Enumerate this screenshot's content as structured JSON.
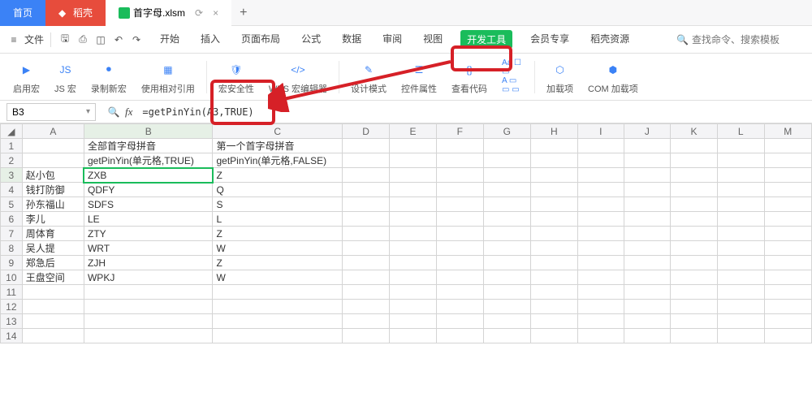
{
  "tabs": {
    "home": "首页",
    "docer": "稻壳",
    "file_icon": "S",
    "file": "首字母.xlsm",
    "plus": "+"
  },
  "menubar": {
    "file_menu": "文件",
    "items": [
      "开始",
      "插入",
      "页面布局",
      "公式",
      "数据",
      "审阅",
      "视图",
      "开发工具",
      "会员专享",
      "稻壳资源"
    ],
    "active_index": 7,
    "search_placeholder": "查找命令、搜索模板"
  },
  "ribbon": {
    "buttons": [
      "启用宏",
      "JS 宏",
      "录制新宏",
      "使用相对引用",
      "宏安全性",
      "WPS 宏编辑器",
      "设计模式",
      "控件属性",
      "查看代码",
      "",
      "加载项",
      "COM 加载项"
    ]
  },
  "namebox": {
    "cell": "B3"
  },
  "formula": {
    "value": "=getPinYin(A3,TRUE)"
  },
  "columns": [
    "A",
    "B",
    "C",
    "D",
    "E",
    "F",
    "G",
    "H",
    "I",
    "J",
    "K",
    "L",
    "M"
  ],
  "rows": [
    {
      "n": 1,
      "A": "",
      "B": "全部首字母拼音",
      "C": "第一个首字母拼音"
    },
    {
      "n": 2,
      "A": "",
      "B": "getPinYin(单元格,TRUE)",
      "C": "getPinYin(单元格,FALSE)"
    },
    {
      "n": 3,
      "A": "赵小包",
      "B": "ZXB",
      "C": "Z"
    },
    {
      "n": 4,
      "A": "钱打防御",
      "B": "QDFY",
      "C": "Q"
    },
    {
      "n": 5,
      "A": "孙东福山",
      "B": "SDFS",
      "C": "S"
    },
    {
      "n": 6,
      "A": "李儿",
      "B": "LE",
      "C": "L"
    },
    {
      "n": 7,
      "A": "周体育",
      "B": "ZTY",
      "C": "Z"
    },
    {
      "n": 8,
      "A": "吴人提",
      "B": "WRT",
      "C": "W"
    },
    {
      "n": 9,
      "A": "郑急后",
      "B": "ZJH",
      "C": "Z"
    },
    {
      "n": 10,
      "A": "王盘空间",
      "B": "WPKJ",
      "C": "W"
    },
    {
      "n": 11,
      "A": "",
      "B": "",
      "C": ""
    },
    {
      "n": 12,
      "A": "",
      "B": "",
      "C": ""
    },
    {
      "n": 13,
      "A": "",
      "B": "",
      "C": ""
    },
    {
      "n": 14,
      "A": "",
      "B": "",
      "C": ""
    }
  ],
  "selected": {
    "col": "B",
    "row": 3
  },
  "annotation": {
    "arrow_from": "dev-tools-tab",
    "arrow_to": "wps-macro-editor"
  }
}
